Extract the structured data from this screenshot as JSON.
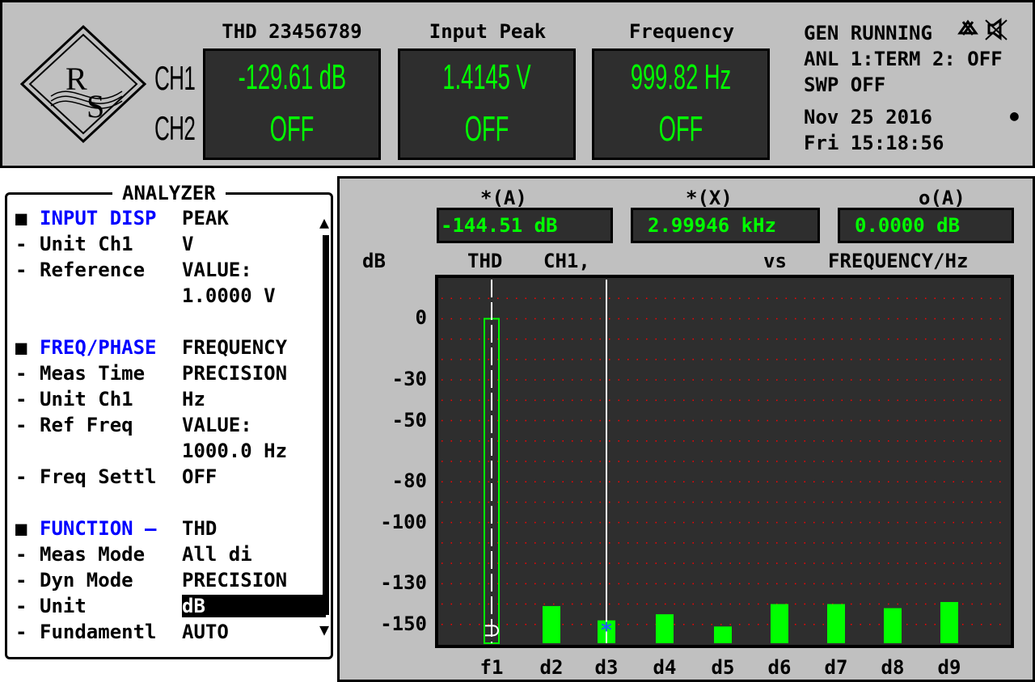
{
  "top": {
    "ch1_label": "CH1",
    "ch2_label": "CH2",
    "columns": [
      {
        "title": "THD 23456789",
        "ch1": "-129.61 dB",
        "ch2": "OFF"
      },
      {
        "title": "Input Peak",
        "ch1": "1.4145  V",
        "ch2": "OFF"
      },
      {
        "title": "Frequency",
        "ch1": "999.82  Hz",
        "ch2": "OFF"
      }
    ],
    "status": {
      "gen": "GEN RUNNING",
      "anl": "ANL 1:TERM 2: OFF",
      "swp": "SWP OFF",
      "date": "Nov 25 2016",
      "time": "Fri 15:18:56"
    }
  },
  "analyzer": {
    "title": "ANALYZER",
    "rows": [
      {
        "bullet": "■",
        "key": "INPUT DISP",
        "value": "PEAK",
        "header": true
      },
      {
        "bullet": "-",
        "key": "Unit Ch1",
        "value": "V"
      },
      {
        "bullet": "-",
        "key": "Reference",
        "value": "VALUE:"
      },
      {
        "bullet": "",
        "key": "",
        "value": "1.0000 V"
      },
      {
        "bullet": "",
        "key": "",
        "value": ""
      },
      {
        "bullet": "■",
        "key": "FREQ/PHASE",
        "value": "FREQUENCY",
        "header": true
      },
      {
        "bullet": "-",
        "key": "Meas Time",
        "value": "PRECISION"
      },
      {
        "bullet": "-",
        "key": "Unit Ch1",
        "value": "Hz"
      },
      {
        "bullet": "-",
        "key": "Ref Freq",
        "value": "VALUE:"
      },
      {
        "bullet": "",
        "key": "",
        "value": "1000.0 Hz"
      },
      {
        "bullet": "-",
        "key": "Freq Settl",
        "value": "OFF"
      },
      {
        "bullet": "",
        "key": "",
        "value": ""
      },
      {
        "bullet": "■",
        "key": "FUNCTION —",
        "value": "THD",
        "header": true
      },
      {
        "bullet": "-",
        "key": "Meas Mode",
        "value": "All di"
      },
      {
        "bullet": "-",
        "key": "Dyn Mode",
        "value": "PRECISION"
      },
      {
        "bullet": "-",
        "key": "Unit",
        "value": "dB",
        "selected": true
      },
      {
        "bullet": "-",
        "key": "Fundamentl",
        "value": "AUTO"
      }
    ]
  },
  "graph": {
    "cursors": [
      {
        "label": "*(A)",
        "value": "-144.51 dB"
      },
      {
        "label": "*(X)",
        "value": "2.99946 kHz"
      },
      {
        "label": "o(A)",
        "value": "0.0000 dB"
      }
    ],
    "header": {
      "unit": "dB",
      "func": "THD",
      "channel": "CH1,",
      "vs": "vs",
      "xaxis": "FREQUENCY/Hz"
    }
  },
  "chart_data": {
    "type": "bar",
    "title": "THD CH1, vs FREQUENCY/Hz",
    "ylabel": "dB",
    "xlabel": "FREQUENCY/Hz",
    "categories": [
      "f1",
      "d2",
      "d3",
      "d4",
      "d5",
      "d6",
      "d7",
      "d8",
      "d9"
    ],
    "values": [
      0,
      -141,
      -148,
      -145,
      -151,
      -140,
      -140,
      -142,
      -139
    ],
    "y_ticks": [
      0,
      -30,
      -50,
      -80,
      -100,
      -130,
      -150
    ],
    "ylim": [
      -160,
      20
    ],
    "grid": true,
    "colors": {
      "bar": "#00ff00",
      "background": "#2e2e2e",
      "grid": "#ff0000",
      "cursor": "#ffffff"
    }
  }
}
